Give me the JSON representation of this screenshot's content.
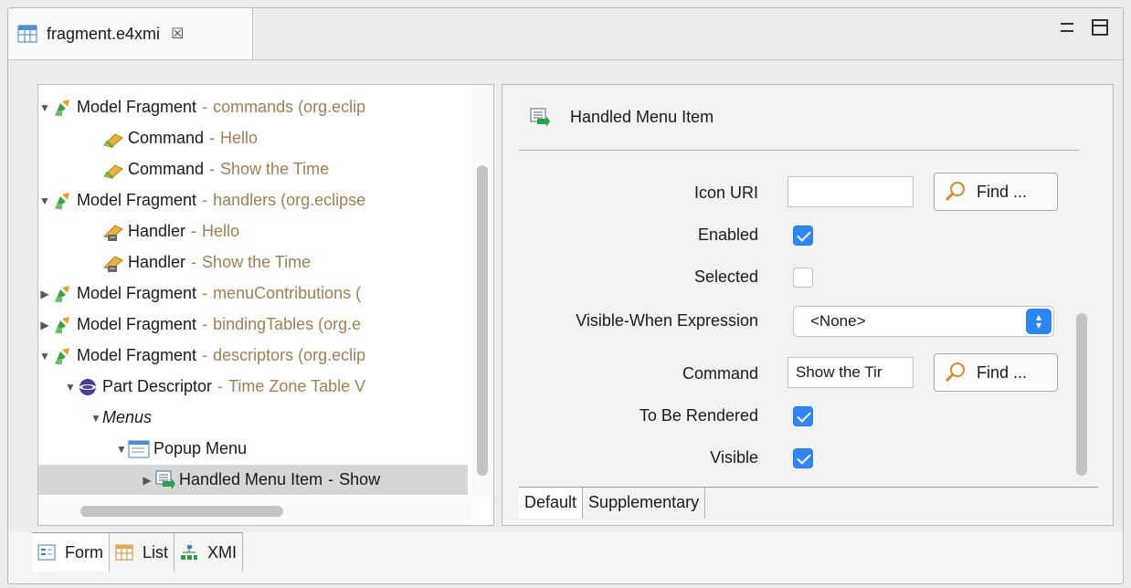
{
  "editor_tab": {
    "title": "fragment.e4xmi",
    "close_glyph": "☒"
  },
  "tree": {
    "rows": [
      {
        "type": "Model Fragment",
        "desc": "commands (org.eclip",
        "icon": "model-fragment-icon",
        "expanded": true
      },
      {
        "type": "Command",
        "desc": "Hello",
        "icon": "command-icon"
      },
      {
        "type": "Command",
        "desc": "Show the Time",
        "icon": "command-icon"
      },
      {
        "type": "Model Fragment",
        "desc": "handlers (org.eclipse",
        "icon": "model-fragment-icon",
        "expanded": true
      },
      {
        "type": "Handler",
        "desc": "Hello",
        "icon": "handler-icon"
      },
      {
        "type": "Handler",
        "desc": "Show the Time",
        "icon": "handler-icon"
      },
      {
        "type": "Model Fragment",
        "desc": "menuContributions (",
        "icon": "model-fragment-icon",
        "expanded": false
      },
      {
        "type": "Model Fragment",
        "desc": "bindingTables (org.e",
        "icon": "model-fragment-icon",
        "expanded": false
      },
      {
        "type": "Model Fragment",
        "desc": "descriptors (org.eclip",
        "icon": "model-fragment-icon",
        "expanded": true
      },
      {
        "type": "Part Descriptor",
        "desc": "Time Zone Table V",
        "icon": "part-descriptor-icon",
        "expanded": true
      },
      {
        "type": "Menus"
      },
      {
        "type": "Popup Menu",
        "icon": "popup-menu-icon",
        "expanded": true
      },
      {
        "type": "Handled Menu Item",
        "desc": "Show",
        "icon": "handled-menu-item-icon",
        "expanded": false
      }
    ]
  },
  "detail": {
    "title": "Handled Menu Item",
    "fields": {
      "icon_uri_label": "Icon URI",
      "icon_uri_value": "",
      "find_label": "Find ...",
      "enabled_label": "Enabled",
      "selected_label": "Selected",
      "visible_when_label": "Visible-When Expression",
      "visible_when_value": "<None>",
      "command_label": "Command",
      "command_value": "Show the Tir",
      "to_be_rendered_label": "To Be Rendered",
      "visible_label": "Visible"
    },
    "checks": {
      "enabled": true,
      "selected": false,
      "to_be_rendered": true,
      "visible": true
    },
    "tabs": [
      "Default",
      "Supplementary"
    ]
  },
  "bottom_tabs": [
    "Form",
    "List",
    "XMI"
  ],
  "colors": {
    "accent": "#2f86f6",
    "desc_text": "#a08050"
  }
}
